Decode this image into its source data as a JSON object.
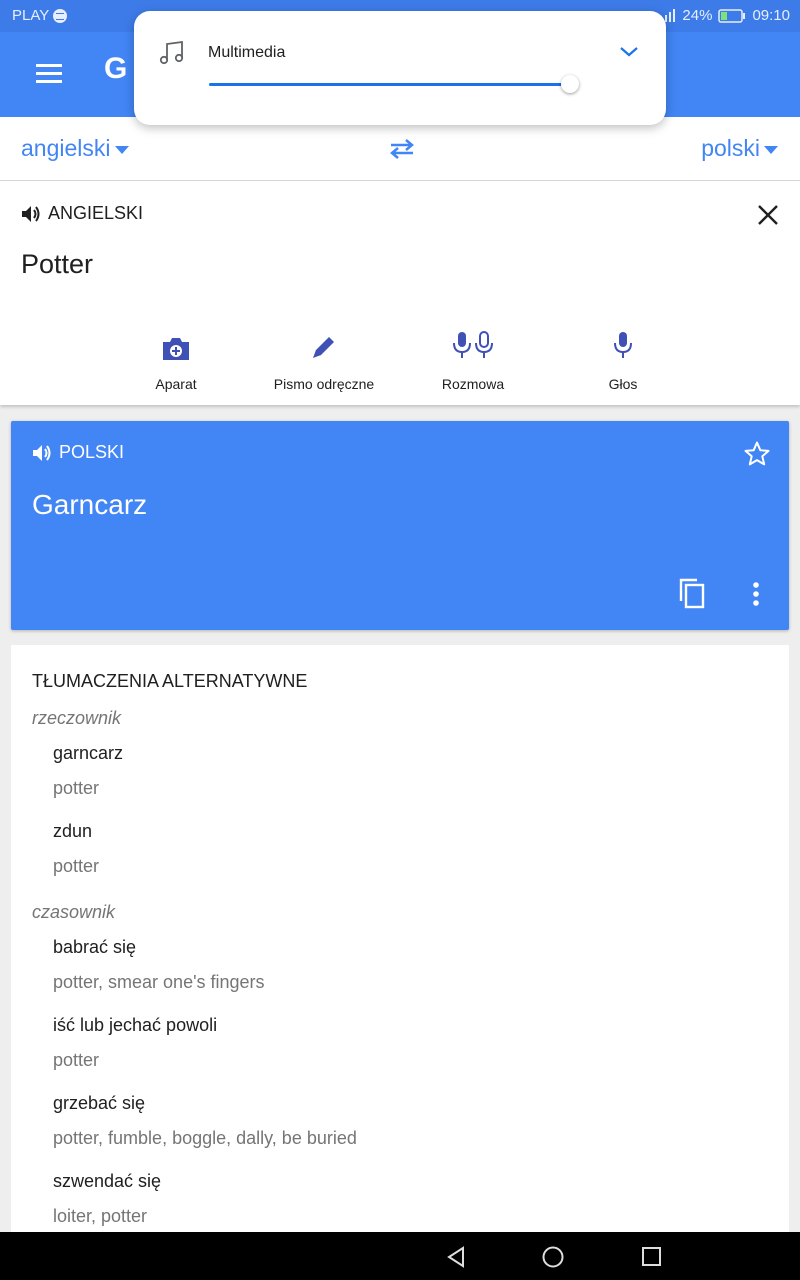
{
  "status_bar": {
    "carrier": "PLAY",
    "battery": "24%",
    "time": "09:10"
  },
  "app_bar": {
    "title_partial": "G"
  },
  "volume_popup": {
    "label": "Multimedia",
    "level": 0.96
  },
  "languages": {
    "source": "angielski",
    "target": "polski"
  },
  "input": {
    "source_lang_label": "ANGIELSKI",
    "text": "Potter",
    "tools": [
      {
        "label": "Aparat",
        "icon": "camera-icon"
      },
      {
        "label": "Pismo odręczne",
        "icon": "pen-icon"
      },
      {
        "label": "Rozmowa",
        "icon": "conversation-icon"
      },
      {
        "label": "Głos",
        "icon": "mic-icon"
      }
    ]
  },
  "output": {
    "target_lang_label": "POLSKI",
    "text": "Garncarz"
  },
  "alternatives": {
    "title": "TŁUMACZENIA ALTERNATYWNE",
    "groups": [
      {
        "pos": "rzeczownik",
        "entries": [
          {
            "term": "garncarz",
            "synonyms": "potter"
          },
          {
            "term": "zdun",
            "synonyms": "potter"
          }
        ]
      },
      {
        "pos": "czasownik",
        "entries": [
          {
            "term": "babrać się",
            "synonyms": "potter, smear one's fingers"
          },
          {
            "term": "iść lub jechać powoli",
            "synonyms": "potter"
          },
          {
            "term": "grzebać się",
            "synonyms": "potter, fumble, boggle, dally, be buried"
          },
          {
            "term": "szwendać się",
            "synonyms": "loiter, potter"
          }
        ]
      }
    ]
  },
  "colors": {
    "accent": "#4285f4",
    "status_bar": "#3d7be8",
    "slider": "#1a73e8"
  }
}
